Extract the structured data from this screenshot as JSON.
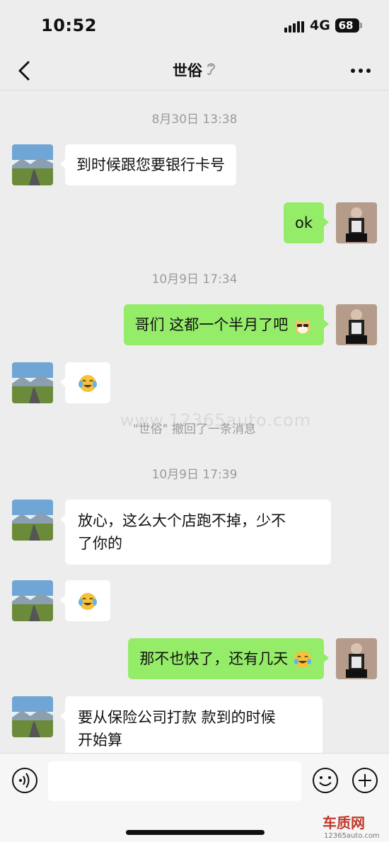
{
  "status_bar": {
    "time": "10:52",
    "network": "4G",
    "battery": "68"
  },
  "nav": {
    "title": "世俗",
    "back_icon": "chevron-left-icon",
    "ear_icon": "ear-icon",
    "more_icon": "more-dots-icon"
  },
  "chat": {
    "timestamps": [
      "8月30日 13:38",
      "10月9日 17:34",
      "10月9日 17:39"
    ],
    "messages": [
      {
        "side": "in",
        "text": "到时候跟您要银行卡号"
      },
      {
        "side": "out",
        "text": "ok"
      },
      {
        "side": "out",
        "text": "哥们 这都一个半月了吧",
        "emoji": "cat-face-emoji"
      },
      {
        "side": "in",
        "text": "",
        "emoji": "crying-laughing-emoji"
      },
      {
        "side": "in",
        "text": "放心，这么大个店跑不掉，少不了你的"
      },
      {
        "side": "in",
        "text": "",
        "emoji": "crying-laughing-emoji"
      },
      {
        "side": "out",
        "text": "那不也快了，还有几天",
        "emoji": "tears-of-joy-emoji"
      },
      {
        "side": "in",
        "text": "要从保险公司打款  款到的时候开始算"
      }
    ],
    "message_lines": {
      "msg5_line1": "放心，这么大个店跑不掉，少不",
      "msg5_line2": "了你的",
      "msg8_line1": "要从保险公司打款  款到的时候",
      "msg8_line2": "开始算"
    },
    "recall_notice": "\"世俗\" 撤回了一条消息"
  },
  "input_bar": {
    "value": "",
    "voice_icon": "voice-icon",
    "emoji_icon": "smiley-icon",
    "plus_icon": "plus-icon"
  },
  "watermark": {
    "text": "www.12365auto.com",
    "logo_text": "车质网",
    "logo_sub": "12365auto.com"
  },
  "colors": {
    "background": "#ededed",
    "bubble_out": "#95ec69",
    "bubble_in": "#ffffff",
    "timestamp": "#9b9b9b"
  }
}
